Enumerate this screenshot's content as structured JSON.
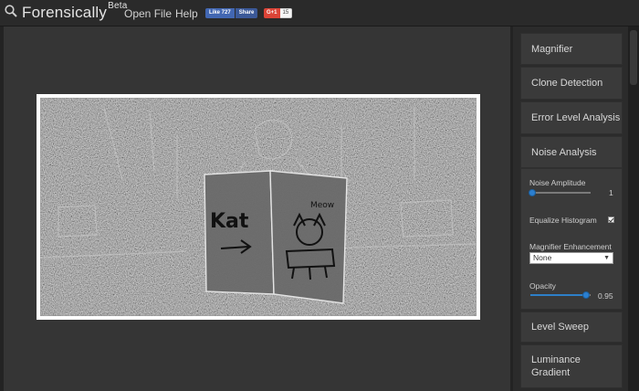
{
  "app": {
    "brand": "Forensically",
    "brand_sup": "Beta",
    "menu": {
      "open_file": "Open File",
      "help": "Help"
    },
    "social": {
      "fb_like": "Like 727",
      "fb_share": "Share",
      "gplus": "G+1",
      "gplus_count": "15"
    }
  },
  "image": {
    "drawing_text_left": "Kat",
    "drawing_text_right": "Meow"
  },
  "sidebar": {
    "tools": [
      {
        "label": "Magnifier"
      },
      {
        "label": "Clone Detection"
      },
      {
        "label": "Error Level Analysis"
      },
      {
        "label": "Noise Analysis"
      },
      {
        "label": "Level Sweep"
      },
      {
        "label": "Luminance Gradient"
      }
    ],
    "noise_panel": {
      "amplitude_label": "Noise Amplitude",
      "amplitude_value": "1",
      "equalize_label": "Equalize Histogram",
      "equalize_checked": true,
      "enhancement_label": "Magnifier Enhancement",
      "enhancement_value": "None",
      "opacity_label": "Opacity",
      "opacity_value": "0.95"
    }
  },
  "colors": {
    "accent": "#2b7fd0",
    "panel": "#3a3a3a",
    "workspace": "#353535"
  }
}
